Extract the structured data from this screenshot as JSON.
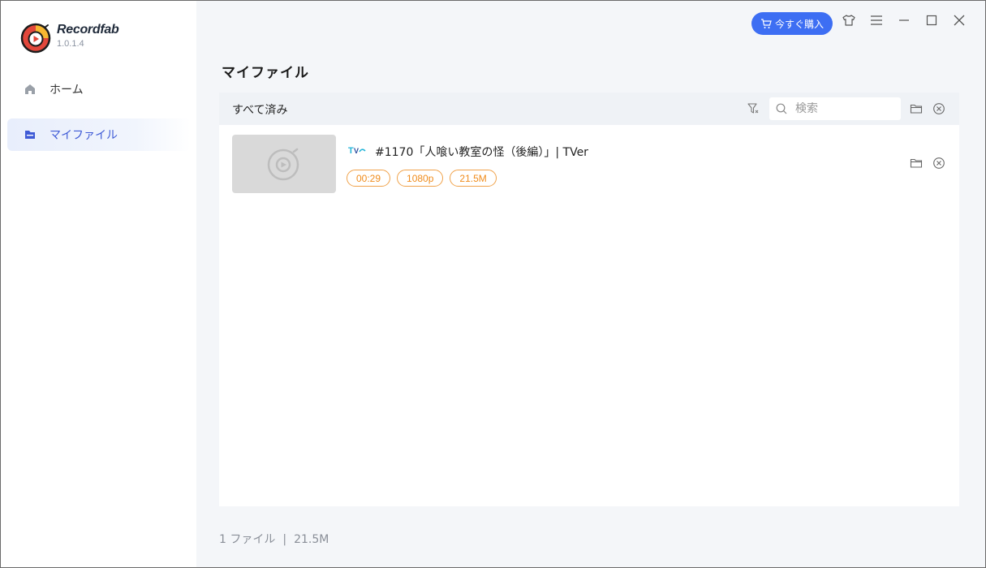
{
  "app": {
    "name": "Recordfab",
    "version": "1.0.1.4"
  },
  "sidebar": {
    "items": [
      {
        "label": "ホーム",
        "icon": "home-icon"
      },
      {
        "label": "マイファイル",
        "icon": "folder-icon"
      }
    ]
  },
  "titlebar": {
    "buy_label": "今すぐ購入"
  },
  "page": {
    "title": "マイファイル"
  },
  "panel": {
    "filter_label": "すべて済み",
    "search_placeholder": "検索",
    "items": [
      {
        "title": "#1170「人喰い教室の怪（後編）」| TVer",
        "source_icon": "tver-icon",
        "tags": [
          "00:29",
          "1080p",
          "21.5M"
        ]
      }
    ]
  },
  "footer": {
    "file_count": "1 ファイル",
    "separator": "|",
    "total_size": "21.5M"
  },
  "colors": {
    "accent": "#3d6ef3",
    "tag": "#f08c1c",
    "active_nav": "#3f5bd6"
  }
}
